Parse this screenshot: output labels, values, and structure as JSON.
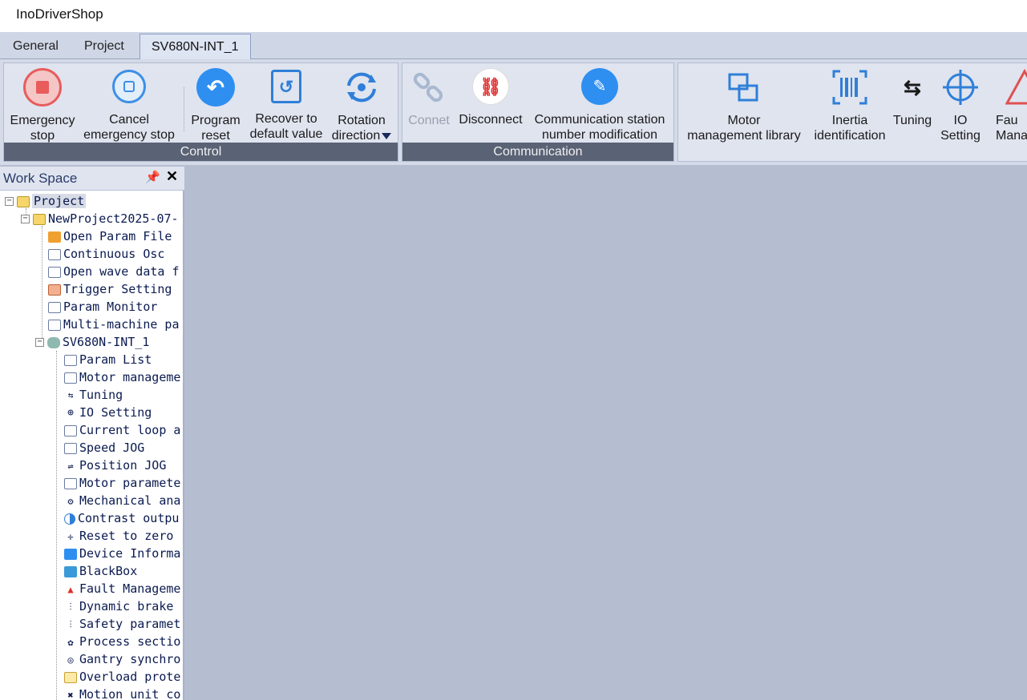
{
  "app": {
    "title": "InoDriverShop"
  },
  "tabs": [
    {
      "label": "General"
    },
    {
      "label": "Project"
    },
    {
      "label": "SV680N-INT_1"
    }
  ],
  "ribbon": {
    "control": {
      "caption": "Control",
      "buttons": [
        {
          "line1": "Emergency",
          "line2": "stop",
          "icon": "stop-circle-icon",
          "color": "#e85c5c"
        },
        {
          "line1": "Cancel",
          "line2": "emergency stop",
          "icon": "cancel-stop-icon",
          "color": "#3d8fe6"
        },
        {
          "line1": "Program",
          "line2": "reset",
          "icon": "undo-icon",
          "color": "#2f8ff0"
        },
        {
          "line1": "Recover to",
          "line2": "default value",
          "icon": "restore-icon",
          "color": "#2f7fd8"
        },
        {
          "line1": "Rotation",
          "line2": "direction",
          "icon": "rotation-icon",
          "color": "#2f7fd8"
        }
      ]
    },
    "communication": {
      "caption": "Communication",
      "buttons": [
        {
          "line1": "Connet",
          "icon": "link-icon",
          "disabled": true
        },
        {
          "line1": "Disconnect",
          "icon": "unlink-icon",
          "color": "#e03030"
        },
        {
          "line1": "Communication station",
          "line2": "number modification",
          "icon": "pencil-icon",
          "color": "#2f8ff0"
        }
      ]
    },
    "tools": {
      "buttons": [
        {
          "line1": "Motor",
          "line2": "management library",
          "icon": "motor-library-icon"
        },
        {
          "line1": "Inertia",
          "line2": "identification",
          "icon": "barcode-icon"
        },
        {
          "line1": "Tuning",
          "icon": "tuning-icon"
        },
        {
          "line1": "IO",
          "line2": "Setting",
          "icon": "crosshair-icon"
        },
        {
          "line1": "Fau",
          "line2": "Manag",
          "icon": "warning-icon"
        }
      ]
    }
  },
  "workspace": {
    "title": "Work Space",
    "tree": [
      {
        "label": "Project"
      },
      {
        "label": "NewProject2025-07-"
      },
      {
        "label": "Open Param File"
      },
      {
        "label": "Continuous Osc"
      },
      {
        "label": "Open wave data f"
      },
      {
        "label": "Trigger Setting"
      },
      {
        "label": "Param Monitor"
      },
      {
        "label": "Multi-machine pa"
      },
      {
        "label": "SV680N-INT_1"
      },
      {
        "label": "Param List"
      },
      {
        "label": "Motor manageme"
      },
      {
        "label": "Tuning"
      },
      {
        "label": "IO Setting"
      },
      {
        "label": "Current loop a"
      },
      {
        "label": "Speed JOG"
      },
      {
        "label": "Position JOG"
      },
      {
        "label": "Motor paramete"
      },
      {
        "label": "Mechanical ana"
      },
      {
        "label": "Contrast outpu"
      },
      {
        "label": "Reset to zero"
      },
      {
        "label": "Device Informa"
      },
      {
        "label": "BlackBox"
      },
      {
        "label": "Fault Manageme"
      },
      {
        "label": "Dynamic brake"
      },
      {
        "label": "Safety paramet"
      },
      {
        "label": "Process sectio"
      },
      {
        "label": "Gantry synchro"
      },
      {
        "label": "Overload prote"
      },
      {
        "label": "Motion unit co"
      }
    ]
  }
}
